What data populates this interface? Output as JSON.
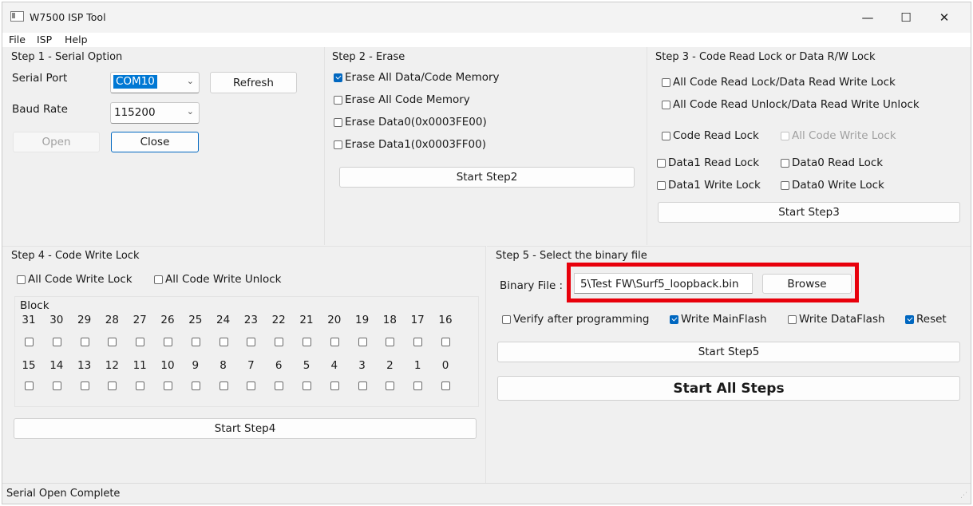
{
  "window": {
    "title": "W7500 ISP Tool",
    "minimize_glyph": "—",
    "maximize_glyph": "☐",
    "close_glyph": "✕"
  },
  "menu": [
    "File",
    "ISP",
    "Help"
  ],
  "step1": {
    "title": "Step 1 - Serial Option",
    "serial_port_label": "Serial Port",
    "serial_port_value": "COM10",
    "refresh_label": "Refresh",
    "baud_rate_label": "Baud Rate",
    "baud_rate_value": "115200",
    "open_label": "Open",
    "close_label": "Close"
  },
  "step2": {
    "title": "Step 2 - Erase",
    "options": [
      {
        "label": "Erase All Data/Code Memory",
        "checked": true
      },
      {
        "label": "Erase All Code Memory",
        "checked": false
      },
      {
        "label": "Erase Data0(0x0003FE00)",
        "checked": false
      },
      {
        "label": "Erase Data1(0x0003FF00)",
        "checked": false
      }
    ],
    "start_label": "Start Step2"
  },
  "step3": {
    "title": "Step 3 - Code Read Lock or Data R/W Lock",
    "all_read_lock": "All Code Read Lock/Data Read Write Lock",
    "all_read_unlock": "All Code Read Unlock/Data Read Write Unlock",
    "code_read_lock": "Code Read Lock",
    "all_code_write_lock": "All Code Write Lock",
    "data1_read_lock": "Data1 Read Lock",
    "data0_read_lock": "Data0 Read Lock",
    "data1_write_lock": "Data1 Write Lock",
    "data0_write_lock": "Data0 Write Lock",
    "start_label": "Start Step3"
  },
  "step4": {
    "title": "Step 4 - Code Write Lock",
    "all_write_lock": "All Code Write Lock",
    "all_write_unlock": "All Code Write Unlock",
    "block_label": "Block",
    "row1": [
      "31",
      "30",
      "29",
      "28",
      "27",
      "26",
      "25",
      "24",
      "23",
      "22",
      "21",
      "20",
      "19",
      "18",
      "17",
      "16"
    ],
    "row2": [
      "15",
      "14",
      "13",
      "12",
      "11",
      "10",
      "9",
      "8",
      "7",
      "6",
      "5",
      "4",
      "3",
      "2",
      "1",
      "0"
    ],
    "start_label": "Start Step4"
  },
  "step5": {
    "title": "Step 5 - Select the binary file",
    "binary_label": "Binary File :",
    "binary_value": "5\\Test FW\\Surf5_loopback.bin",
    "browse_label": "Browse",
    "verify_label": "Verify after programming",
    "write_main_label": "Write MainFlash",
    "write_data_label": "Write DataFlash",
    "reset_label": "Reset",
    "start_label": "Start Step5",
    "start_all_label": "Start All Steps"
  },
  "status": {
    "text": "Serial Open Complete"
  },
  "colors": {
    "highlight": "#e8000b",
    "accent": "#0067c0"
  }
}
